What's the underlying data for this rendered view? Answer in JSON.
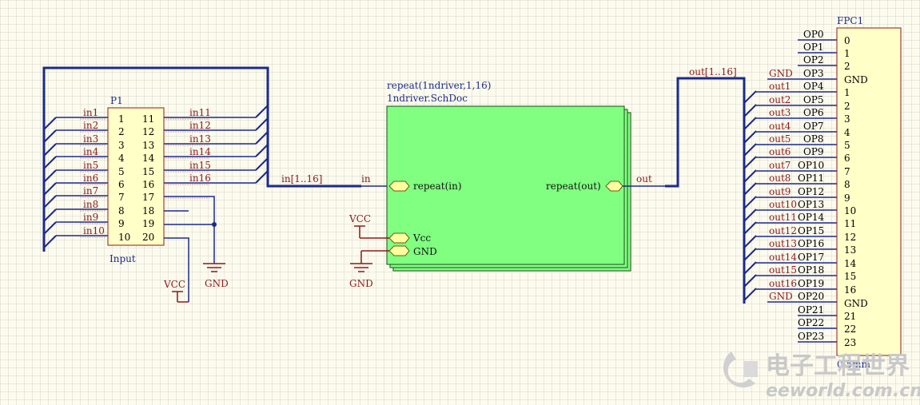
{
  "p1": {
    "designator": "P1",
    "comment": "Input",
    "pins_left": [
      "1",
      "2",
      "3",
      "4",
      "5",
      "6",
      "7",
      "8",
      "9",
      "10"
    ],
    "pins_right": [
      "11",
      "12",
      "13",
      "14",
      "15",
      "16",
      "17",
      "18",
      "19",
      "20"
    ],
    "nets_left": [
      "in1",
      "in2",
      "in3",
      "in4",
      "in5",
      "in6",
      "in7",
      "in8",
      "in9",
      "in10"
    ],
    "nets_right": [
      "in11",
      "in12",
      "in13",
      "in14",
      "in15",
      "in16"
    ]
  },
  "bus_in_label": "in[1..16]",
  "bus_out_label": "out[1..16]",
  "net_in": "in",
  "net_out": "out",
  "sheet": {
    "designator": "repeat(1ndriver,1,16)",
    "filename": "1ndriver.SchDoc",
    "port_in": "repeat(in)",
    "port_out": "repeat(out)",
    "port_vcc": "Vcc",
    "port_gnd": "GND"
  },
  "power": {
    "vcc": "VCC",
    "gnd": "GND"
  },
  "fpc": {
    "designator": "FPC1",
    "comment": "0.5mm",
    "rows": [
      {
        "net": "",
        "op": "OP0",
        "pin": "0"
      },
      {
        "net": "",
        "op": "OP1",
        "pin": "1"
      },
      {
        "net": "",
        "op": "OP2",
        "pin": "2"
      },
      {
        "net": "GND",
        "op": "OP3",
        "pin": "GND"
      },
      {
        "net": "out1",
        "op": "OP4",
        "pin": "1"
      },
      {
        "net": "out2",
        "op": "OP5",
        "pin": "2"
      },
      {
        "net": "out3",
        "op": "OP6",
        "pin": "3"
      },
      {
        "net": "out4",
        "op": "OP7",
        "pin": "4"
      },
      {
        "net": "out5",
        "op": "OP8",
        "pin": "5"
      },
      {
        "net": "out6",
        "op": "OP9",
        "pin": "6"
      },
      {
        "net": "out7",
        "op": "OP10",
        "pin": "7"
      },
      {
        "net": "out8",
        "op": "OP11",
        "pin": "8"
      },
      {
        "net": "out9",
        "op": "OP12",
        "pin": "9"
      },
      {
        "net": "out10",
        "op": "OP13",
        "pin": "10"
      },
      {
        "net": "out11",
        "op": "OP14",
        "pin": "11"
      },
      {
        "net": "out12",
        "op": "OP15",
        "pin": "12"
      },
      {
        "net": "out13",
        "op": "OP16",
        "pin": "13"
      },
      {
        "net": "out14",
        "op": "OP17",
        "pin": "14"
      },
      {
        "net": "out15",
        "op": "OP18",
        "pin": "15"
      },
      {
        "net": "out16",
        "op": "OP19",
        "pin": "16"
      },
      {
        "net": "GND",
        "op": "OP20",
        "pin": "GND"
      },
      {
        "net": "",
        "op": "OP21",
        "pin": "21"
      },
      {
        "net": "",
        "op": "OP22",
        "pin": "22"
      },
      {
        "net": "",
        "op": "OP23",
        "pin": "23"
      }
    ]
  },
  "watermark": {
    "line1": "电子工程世界",
    "line2": "eeworld.com.cn"
  },
  "colors": {
    "wire": "#1c2a8c",
    "net_label": "#8b1a1a",
    "component_fill": "#ffffc8",
    "sheet_fill": "#80ff80",
    "port_fill": "#ffffa0",
    "power": "#8b1a1a"
  }
}
